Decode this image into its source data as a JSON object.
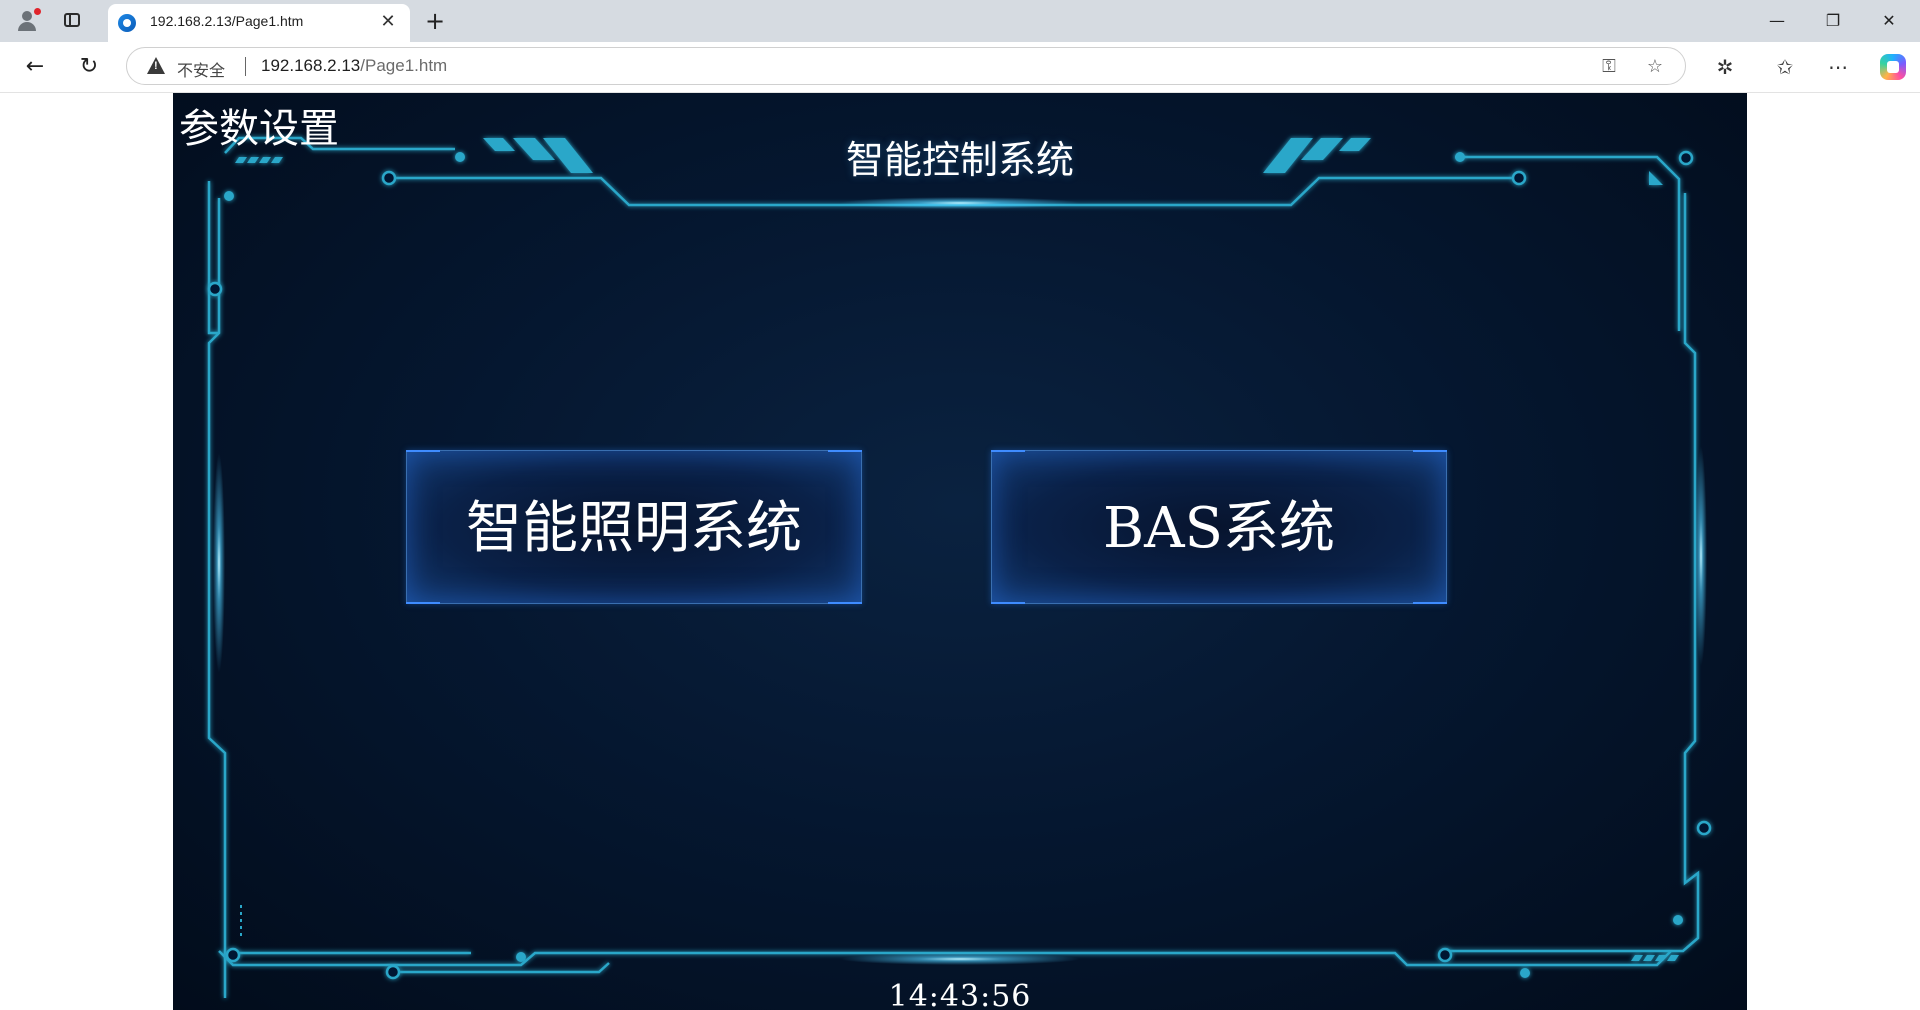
{
  "browser": {
    "tab_title": "192.168.2.13/Page1.htm",
    "security_label": "不安全",
    "url_host": "192.168.2.13",
    "url_path": "/Page1.htm",
    "icons": {
      "profile": "profile-icon",
      "tabs": "tab-actions-icon",
      "favicon": "edge-favicon-icon",
      "close_tab": "close-icon",
      "new_tab": "plus-icon",
      "back": "back-arrow-icon",
      "reload": "reload-icon",
      "warning": "warning-icon",
      "key": "key-icon",
      "favorite": "star-icon",
      "extensions": "puzzle-icon",
      "favorites": "favorites-icon",
      "more": "more-icon",
      "copilot": "copilot-icon",
      "minimize": "minimize-icon",
      "restore": "restore-icon",
      "close_window": "close-icon"
    }
  },
  "hmi": {
    "settings_label": "参数设置",
    "title": "智能控制系统",
    "buttons": [
      {
        "label": "智能照明系统"
      },
      {
        "label": "BAS系统"
      }
    ],
    "time": "14:43:56",
    "colors": {
      "background": "#051730",
      "frame_line": "#2aa7c9",
      "button_border": "#3f8cff",
      "text": "#ffffff"
    }
  }
}
